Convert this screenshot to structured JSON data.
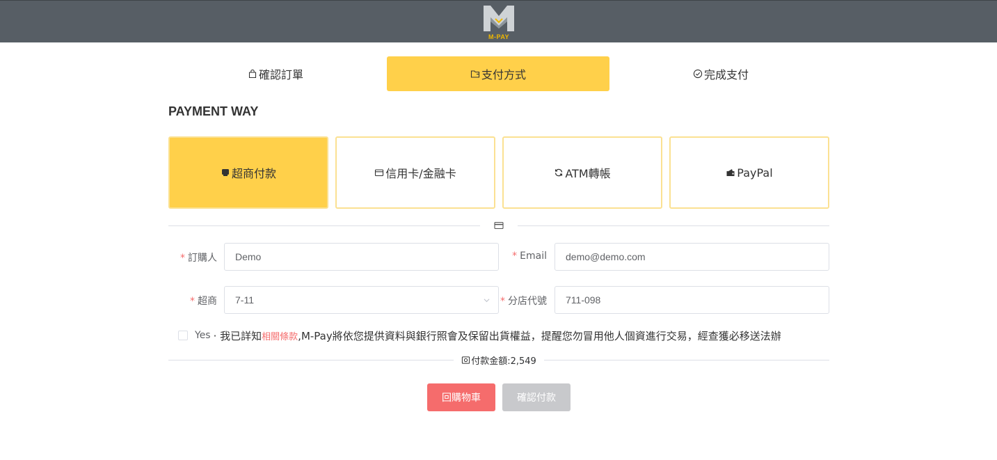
{
  "header": {
    "logo_text": "M-PAY"
  },
  "steps": [
    {
      "label": "確認訂單",
      "icon": "shopping-bag-icon"
    },
    {
      "label": "支付方式",
      "icon": "wallet-icon"
    },
    {
      "label": "完成支付",
      "icon": "check-circle-icon"
    }
  ],
  "section_title": "PAYMENT WAY",
  "methods": [
    {
      "label": "超商付款",
      "icon": "store-icon"
    },
    {
      "label": "信用卡/金融卡",
      "icon": "credit-card-icon"
    },
    {
      "label": "ATM轉帳",
      "icon": "refresh-icon"
    },
    {
      "label": "PayPal",
      "icon": "wallet-icon"
    }
  ],
  "form": {
    "buyer": {
      "label": "訂購人",
      "value": "Demo"
    },
    "email": {
      "label": "Email",
      "value": "demo@demo.com"
    },
    "store": {
      "label": "超商",
      "value": "7-11"
    },
    "branch": {
      "label": "分店代號",
      "value": "711-098"
    },
    "required_mark": "*"
  },
  "agreement": {
    "yes": "Yes",
    "text_before": "· 我已詳知",
    "link": "相關條款",
    "text_after": ",M-Pay將依您提供資料與銀行照會及保留出貨權益，提醒您勿冒用他人個資進行交易，經查獲必移送法辦"
  },
  "amount": {
    "label": "付款金額:2,549"
  },
  "buttons": {
    "back": "回購物車",
    "confirm": "確認付款"
  },
  "colors": {
    "accent": "#ffd04a",
    "header": "#575e65",
    "danger": "#f56c6c",
    "disabled": "#c8c9cc"
  }
}
